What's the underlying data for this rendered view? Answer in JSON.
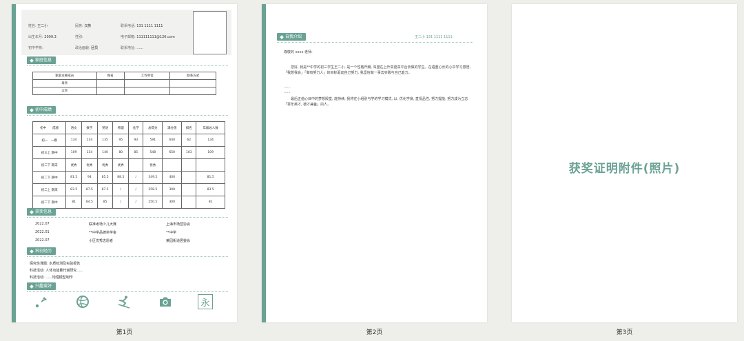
{
  "page1": {
    "basic": [
      {
        "label": "姓名:",
        "value": "王二小"
      },
      {
        "label": "民族:",
        "value": "汉族"
      },
      {
        "label": "联系电话:",
        "value": "131 1111 1111"
      },
      {
        "label": "出生年月:",
        "value": "2009.3"
      },
      {
        "label": "性别:",
        "value": ""
      },
      {
        "label": "电子邮箱:",
        "value": "111111111@126.com"
      },
      {
        "label": "初中学校:",
        "value": ""
      },
      {
        "label": "政治面貌:",
        "value": "团员"
      },
      {
        "label": "联系地址:",
        "value": "......"
      }
    ],
    "family": {
      "title": "家庭信息",
      "headers": [
        "家庭主要成员",
        "姓名",
        "工作单位",
        "联系方式"
      ],
      "rows": [
        [
          "母亲",
          "",
          "",
          ""
        ],
        [
          "父亲",
          "",
          "",
          ""
        ]
      ]
    },
    "grades": {
      "title": "初中成绩",
      "headers": [
        "初中　　成绩",
        "语文",
        "数学",
        "英语",
        "物理",
        "化学",
        "总得分",
        "满分值",
        "排名",
        "年级总人数"
      ],
      "rows": [
        [
          "初一　一模",
          "134",
          "134",
          "135",
          "95",
          "93",
          "591",
          "640",
          "62",
          "134"
        ],
        [
          "初三上 期中",
          "109",
          "134",
          "140",
          "80",
          "85",
          "548",
          "650",
          "103",
          "109"
        ],
        [
          "初二下 期末",
          "优秀",
          "优秀",
          "优秀",
          "优秀",
          "",
          "优秀",
          "",
          "",
          ""
        ],
        [
          "初二下 期中",
          "81.5",
          "94",
          "85.5",
          "88.5",
          "/",
          "349.5",
          "400",
          "",
          "81.5"
        ],
        [
          "初二上 期末",
          "83.5",
          "87.5",
          "87.5",
          "/",
          "/",
          "258.5",
          "300",
          "",
          "83.5"
        ],
        [
          "初二下 期中",
          "81",
          "84.5",
          "85",
          "/",
          "/",
          "250.5",
          "300",
          "",
          "81"
        ]
      ]
    },
    "awards": {
      "title": "获奖信息",
      "rows": [
        [
          "2022.07",
          "联准考场少儿大赛",
          "上海市场营协会"
        ],
        [
          "2022.01",
          "**中学品德奖学金",
          "**中学"
        ],
        [
          "2022.07",
          "小区优秀志愿者",
          "莱园街道居委会"
        ]
      ]
    },
    "experience": {
      "title": "科创经历",
      "rows": [
        "探究性课题: 水质检测及实验报告",
        "科技活动: 人体功能量代谢研究......",
        "科技活动: ......地理模型制作"
      ]
    },
    "hobbies": {
      "title": "兴趣爱好",
      "icons": [
        "badminton-icon",
        "volleyball-icon",
        "skiing-icon",
        "camera-icon",
        "calligraphy-icon"
      ],
      "calligraphy_char": "永"
    },
    "label": "第1页"
  },
  "page2": {
    "section_title": "自我介绍",
    "contact": "王二小 131 1111 1111",
    "greeting": "尊敬的 xxxx 老师:",
    "para1": "　　您好, 我是**中学的初三学生王二小, 是一个性格开朗, 渴望在上升高更高平台去做的学生。在语重心长的心中学习感悟, 「我想我会」「做有努力人」的目标驱动自己努力, 我坚信做一事去实践与自己能力。",
    "dots1": "......",
    "dots2": "......",
    "para2": "　　最后正值心目中的梦想殿堂, 能持续, 我将在小组别与学的学习模式, 以, 优化学良, 直视品性, 努力提能, 努力成为立志「百年英才, 德才兼备」的人。",
    "label": "第2页"
  },
  "page3": {
    "title": "获奖证明附件(照片)",
    "label": "第3页"
  },
  "colors": {
    "accent": "#6aa294",
    "background": "#eeeeea"
  }
}
